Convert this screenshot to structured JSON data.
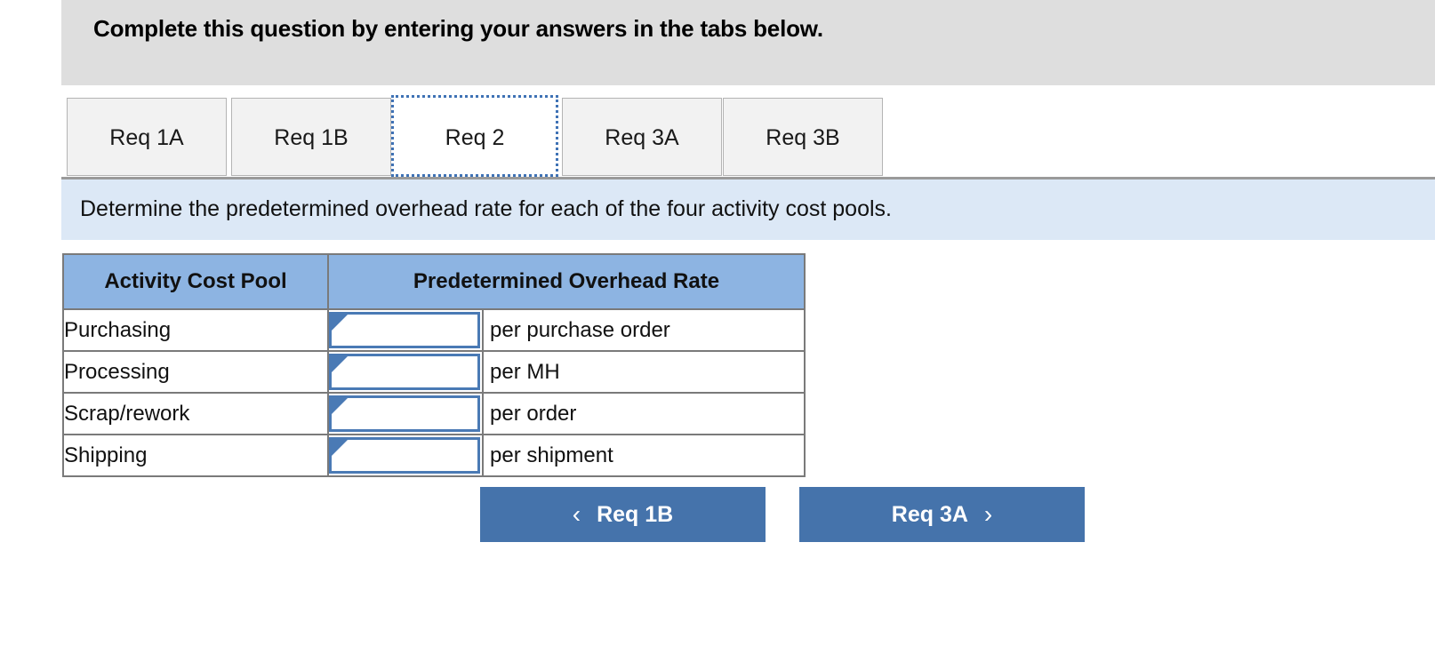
{
  "header": {
    "banner_text": "Complete this question by entering your answers in the tabs below.",
    "background_color": "#dedede"
  },
  "tabs": {
    "items": [
      {
        "label": "Req 1A",
        "active": false
      },
      {
        "label": "Req 1B",
        "active": false
      },
      {
        "label": "Req 2",
        "active": true
      },
      {
        "label": "Req 3A",
        "active": false
      },
      {
        "label": "Req 3B",
        "active": false
      }
    ],
    "active_tab": "Req 2",
    "active_border_color": "#3f72b5",
    "inactive_background": "#f2f2f2"
  },
  "instruction": {
    "text": "Determine the predetermined overhead rate for each of the four activity cost pools.",
    "background_color": "#dce8f6"
  },
  "table": {
    "header_background": "#8db4e2",
    "columns": [
      "Activity Cost Pool",
      "Predetermined Overhead Rate"
    ],
    "rows": [
      {
        "pool": "Purchasing",
        "rate_value": "",
        "unit": "per purchase order"
      },
      {
        "pool": "Processing",
        "rate_value": "",
        "unit": "per MH"
      },
      {
        "pool": "Scrap/rework",
        "rate_value": "",
        "unit": "per order"
      },
      {
        "pool": "Shipping",
        "rate_value": "",
        "unit": "per shipment"
      }
    ],
    "input_placeholder": "",
    "input_border_color": "#4a7ab5"
  },
  "navigation": {
    "prev_label": "Req 1B",
    "next_label": "Req 3A",
    "prev_icon": "chevron-left-icon",
    "next_icon": "chevron-right-icon",
    "prev_chevron": "‹",
    "next_chevron": "›",
    "button_color": "#4573ab"
  }
}
